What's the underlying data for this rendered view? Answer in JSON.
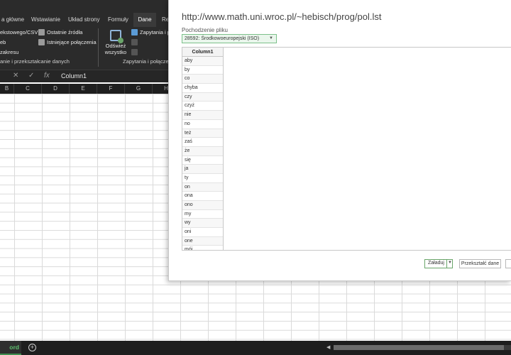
{
  "ribbon": {
    "tabs": [
      "a główne",
      "Wstawianie",
      "Układ strony",
      "Formuły",
      "Dane",
      "Re"
    ],
    "active_tab": "Dane",
    "get_data": {
      "from_text": "ekstowego/CSV",
      "from_web": "eb",
      "from_range": "zakresu",
      "recent_sources": "Ostatnie źródła",
      "existing_connections": "Istniejące połączenia",
      "group_label": "anie i przekształcanie danych"
    },
    "refresh_all": {
      "line1": "Odśwież",
      "line2": "wszystko"
    },
    "queries": {
      "item1": "Zapytania i p",
      "group_label": "Zapytania i połączen"
    }
  },
  "formula_bar": {
    "cancel_symbol": "✕",
    "enter_symbol": "✓",
    "fx_symbol": "fx",
    "value": "Column1"
  },
  "columns": [
    "B",
    "C",
    "D",
    "E",
    "F",
    "G",
    "H"
  ],
  "sheet": {
    "tab_label": "ord",
    "add_symbol": "+"
  },
  "dialog": {
    "title": "http://www.math.uni.wroc.pl/~hebisch/prog/pol.lst",
    "origin_label": "Pochodzenie pliku",
    "origin_value": "28592: Środkowoeuropejski (ISO)",
    "preview_header": "Column1",
    "preview_rows": [
      "aby",
      "by",
      "co",
      "chyba",
      "czy",
      "czyż",
      "nie",
      "no",
      "też",
      "zaś",
      "że",
      "się",
      "ja",
      "ty",
      "on",
      "ona",
      "ono",
      "my",
      "wy",
      "oni",
      "one",
      "mój"
    ],
    "load_label": "Załaduj",
    "transform_label": "Przekształć dane"
  }
}
